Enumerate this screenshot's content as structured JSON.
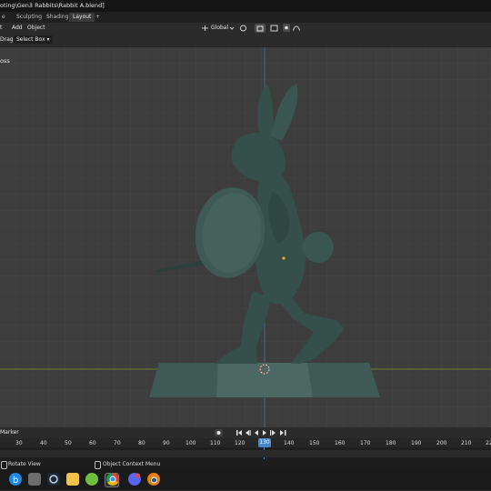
{
  "window": {
    "title": "oting\\Gen3 Rabbits\\Rabbit A.blend]"
  },
  "workspace_tabs": [
    {
      "label": "e"
    },
    {
      "label": "Sculpting"
    },
    {
      "label": "Shading"
    },
    {
      "label": "Layout",
      "active": true
    },
    {
      "label": "+"
    }
  ],
  "header_menu": {
    "items": [
      "t",
      "Add",
      "Object"
    ]
  },
  "transform": {
    "orientation": "Global"
  },
  "toolbar": {
    "drag_label": "Drag:",
    "select_mode": "Select Box"
  },
  "viewport": {
    "overlay_label": "oss"
  },
  "timeline": {
    "marker_label": "Marker",
    "current_frame": "130",
    "ruler": [
      "30",
      "40",
      "50",
      "60",
      "70",
      "80",
      "90",
      "100",
      "110",
      "120",
      "130",
      "140",
      "150",
      "160",
      "170",
      "180",
      "190",
      "200",
      "210",
      "22"
    ]
  },
  "status": {
    "left_hint": "Rotate View",
    "right_hint": "Object Context Menu"
  },
  "taskbar": {
    "icons": [
      "edge-icon",
      "file-explorer-icon",
      "steam-icon",
      "folder-icon",
      "greenshot-icon",
      "terminal-icon",
      "chrome-icon",
      "discord-icon",
      "blender-icon"
    ]
  },
  "colors": {
    "viewport_bg": "#3d3d3d",
    "grid": "#454545",
    "axis_red": "#5a3a3a",
    "axis_green": "#6f7a2e",
    "axis_blue": "#3c6a8f",
    "model": "#35504b",
    "model_light": "#4b6863",
    "playhead": "#4a86c7"
  }
}
